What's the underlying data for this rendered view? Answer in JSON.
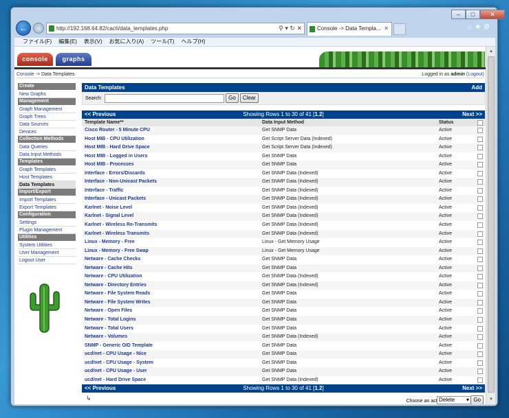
{
  "browser": {
    "url": "http://192.168.64.82/cacti/data_templates.php",
    "tab_title": "Console -> Data Templa...",
    "menu": [
      "ファイル(F)",
      "編集(E)",
      "表示(V)",
      "お気に入り(A)",
      "ツール(T)",
      "ヘルプ(H)"
    ]
  },
  "top_tabs": {
    "console": "console",
    "graphs": "graphs"
  },
  "breadcrumb": {
    "console": "Console",
    "current": " -> Data Templates",
    "logged_prefix": "Logged in as ",
    "user": "admin",
    "logout": "(Logout)"
  },
  "sidebar": [
    {
      "type": "head",
      "label": "Create"
    },
    {
      "type": "item",
      "label": "New Graphs"
    },
    {
      "type": "head",
      "label": "Management"
    },
    {
      "type": "item",
      "label": "Graph Management"
    },
    {
      "type": "item",
      "label": "Graph Trees"
    },
    {
      "type": "item",
      "label": "Data Sources"
    },
    {
      "type": "item",
      "label": "Devices"
    },
    {
      "type": "head",
      "label": "Collection Methods"
    },
    {
      "type": "item",
      "label": "Data Queries"
    },
    {
      "type": "item",
      "label": "Data Input Methods"
    },
    {
      "type": "head",
      "label": "Templates"
    },
    {
      "type": "item",
      "label": "Graph Templates"
    },
    {
      "type": "item",
      "label": "Host Templates"
    },
    {
      "type": "item",
      "label": "Data Templates",
      "selected": true
    },
    {
      "type": "head",
      "label": "Import/Export"
    },
    {
      "type": "item",
      "label": "Import Templates"
    },
    {
      "type": "item",
      "label": "Export Templates"
    },
    {
      "type": "head",
      "label": "Configuration"
    },
    {
      "type": "item",
      "label": "Settings"
    },
    {
      "type": "item",
      "label": "Plugin Management"
    },
    {
      "type": "head",
      "label": "Utilities"
    },
    {
      "type": "item",
      "label": "System Utilities"
    },
    {
      "type": "item",
      "label": "User Management"
    },
    {
      "type": "item",
      "label": "Logout User"
    }
  ],
  "panel": {
    "title": "Data Templates",
    "add": "Add",
    "search_label": "Search:",
    "go": "Go",
    "clear": "Clear"
  },
  "pager": {
    "prev": "<< Previous",
    "info": "Showing Rows 1 to 30 of 41 [",
    "page1": "1",
    "comma": ",",
    "page2": "2",
    "close": "]",
    "next": "Next >>"
  },
  "columns": {
    "name": "Template Name**",
    "method": "Data Input Method",
    "status": "Status"
  },
  "rows": [
    {
      "name": "Cisco Router - 5 Minute CPU",
      "method": "Get SNMP Data",
      "status": "Active"
    },
    {
      "name": "Host MIB - CPU Utilization",
      "method": "Get Script Server Data (Indexed)",
      "status": "Active"
    },
    {
      "name": "Host MIB - Hard Drive Space",
      "method": "Get Script Server Data (Indexed)",
      "status": "Active"
    },
    {
      "name": "Host MIB - Logged in Users",
      "method": "Get SNMP Data",
      "status": "Active"
    },
    {
      "name": "Host MIB - Processes",
      "method": "Get SNMP Data",
      "status": "Active"
    },
    {
      "name": "Interface - Errors/Discards",
      "method": "Get SNMP Data (Indexed)",
      "status": "Active"
    },
    {
      "name": "Interface - Non-Unicast Packets",
      "method": "Get SNMP Data (Indexed)",
      "status": "Active"
    },
    {
      "name": "Interface - Traffic",
      "method": "Get SNMP Data (Indexed)",
      "status": "Active"
    },
    {
      "name": "Interface - Unicast Packets",
      "method": "Get SNMP Data (Indexed)",
      "status": "Active"
    },
    {
      "name": "Karlnet - Noise Level",
      "method": "Get SNMP Data (Indexed)",
      "status": "Active"
    },
    {
      "name": "Karlnet - Signal Level",
      "method": "Get SNMP Data (Indexed)",
      "status": "Active"
    },
    {
      "name": "Karlnet - Wireless Re-Transmits",
      "method": "Get SNMP Data (Indexed)",
      "status": "Active"
    },
    {
      "name": "Karlnet - Wireless Transmits",
      "method": "Get SNMP Data (Indexed)",
      "status": "Active"
    },
    {
      "name": "Linux - Memory - Free",
      "method": "Linux - Get Memory Usage",
      "status": "Active"
    },
    {
      "name": "Linux - Memory - Free Swap",
      "method": "Linux - Get Memory Usage",
      "status": "Active"
    },
    {
      "name": "Netware - Cache Checks",
      "method": "Get SNMP Data",
      "status": "Active"
    },
    {
      "name": "Netware - Cache Hits",
      "method": "Get SNMP Data",
      "status": "Active"
    },
    {
      "name": "Netware - CPU Utilization",
      "method": "Get SNMP Data (Indexed)",
      "status": "Active"
    },
    {
      "name": "Netware - Directory Entries",
      "method": "Get SNMP Data (Indexed)",
      "status": "Active"
    },
    {
      "name": "Netware - File System Reads",
      "method": "Get SNMP Data",
      "status": "Active"
    },
    {
      "name": "Netware - File System Writes",
      "method": "Get SNMP Data",
      "status": "Active"
    },
    {
      "name": "Netware - Open Files",
      "method": "Get SNMP Data",
      "status": "Active"
    },
    {
      "name": "Netware - Total Logins",
      "method": "Get SNMP Data",
      "status": "Active"
    },
    {
      "name": "Netware - Total Users",
      "method": "Get SNMP Data",
      "status": "Active"
    },
    {
      "name": "Netware - Volumes",
      "method": "Get SNMP Data (Indexed)",
      "status": "Active"
    },
    {
      "name": "SNMP - Generic OID Template",
      "method": "Get SNMP Data",
      "status": "Active"
    },
    {
      "name": "ucd/net - CPU Usage - Nice",
      "method": "Get SNMP Data",
      "status": "Active"
    },
    {
      "name": "ucd/net - CPU Usage - System",
      "method": "Get SNMP Data",
      "status": "Active"
    },
    {
      "name": "ucd/net - CPU Usage - User",
      "method": "Get SNMP Data",
      "status": "Active"
    },
    {
      "name": "ucd/net - Hard Drive Space",
      "method": "Get SNMP Data (Indexed)",
      "status": "Active"
    }
  ],
  "footer": {
    "action_label": "Choose an action:",
    "action_value": "Delete",
    "go": "Go"
  }
}
